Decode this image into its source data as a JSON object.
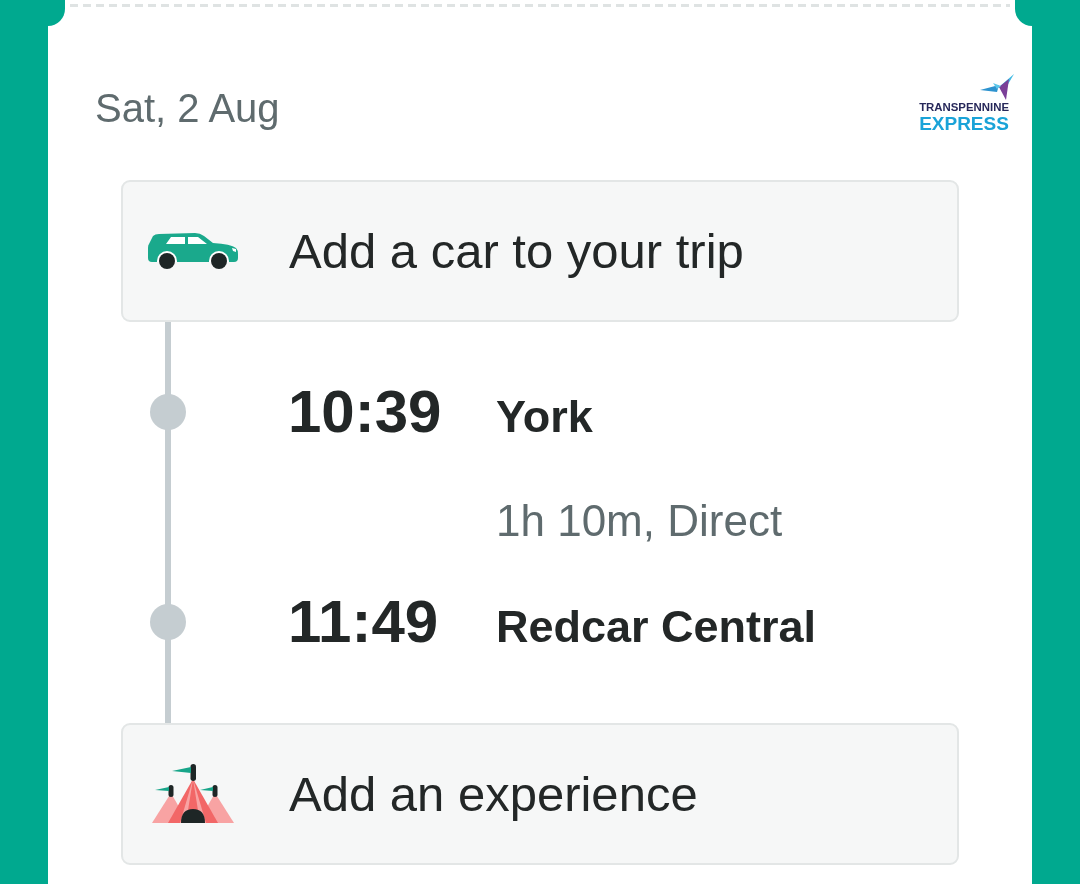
{
  "ticket": {
    "date": "Sat, 2 Aug",
    "operator_logo": {
      "top_line": "TRANSPENNINE",
      "bottom_line": "EXPRESS"
    }
  },
  "car_offer": {
    "label": "Add a car to your trip"
  },
  "journey": {
    "stops": [
      {
        "time": "10:39",
        "station": "York"
      },
      {
        "time": "11:49",
        "station": "Redcar Central"
      }
    ],
    "summary": "1h 10m, Direct"
  },
  "experience_offer": {
    "label": "Add an experience"
  }
}
